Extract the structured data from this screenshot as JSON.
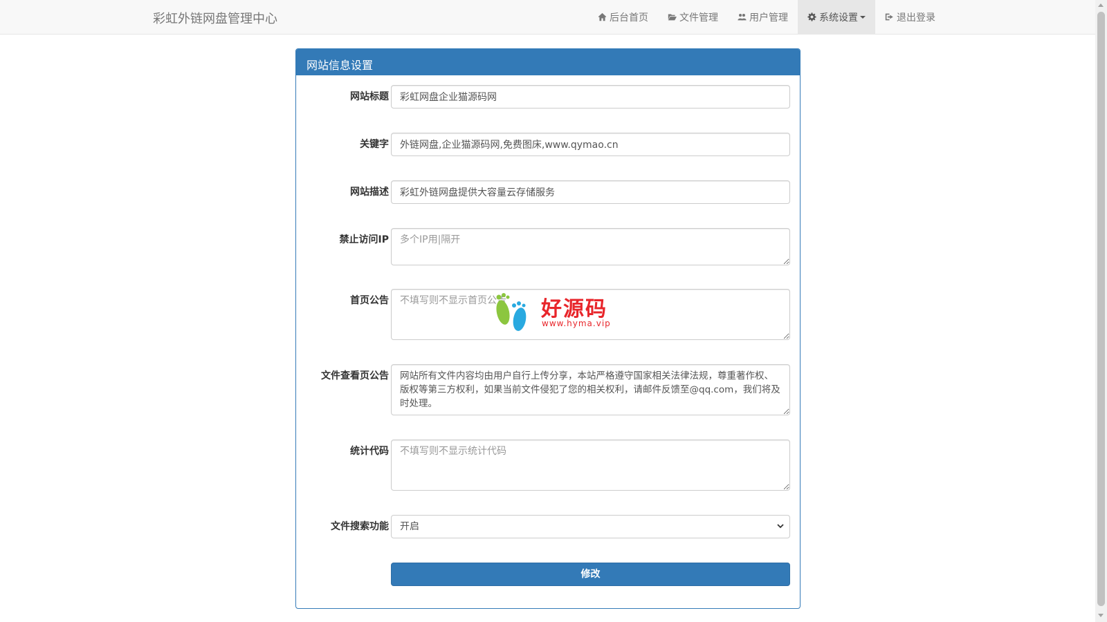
{
  "navbar": {
    "brand": "彩虹外链网盘管理中心",
    "items": [
      {
        "label": "后台首页",
        "icon": "home-icon"
      },
      {
        "label": "文件管理",
        "icon": "folder-open-icon"
      },
      {
        "label": "用户管理",
        "icon": "users-icon"
      },
      {
        "label": "系统设置",
        "icon": "gear-icon",
        "active": true
      },
      {
        "label": "退出登录",
        "icon": "sign-out-icon"
      }
    ]
  },
  "panel": {
    "title": "网站信息设置",
    "fields": {
      "site_title": {
        "label": "网站标题",
        "value": "彩虹网盘企业猫源码网"
      },
      "keywords": {
        "label": "关键字",
        "value": "外链网盘,企业猫源码网,免费图床,www.qymao.cn"
      },
      "description": {
        "label": "网站描述",
        "value": "彩虹外链网盘提供大容量云存储服务"
      },
      "banned_ip": {
        "label": "禁止访问IP",
        "placeholder": "多个IP用|隔开"
      },
      "home_notice": {
        "label": "首页公告",
        "placeholder": "不填写则不显示首页公告"
      },
      "file_notice": {
        "label": "文件查看页公告",
        "value": "网站所有文件内容均由用户自行上传分享，本站严格遵守国家相关法律法规，尊重著作权、版权等第三方权利，如果当前文件侵犯了您的相关权利，请邮件反馈至@qq.com，我们将及时处理。"
      },
      "stats_code": {
        "label": "统计代码",
        "placeholder": "不填写则不显示统计代码"
      },
      "file_search": {
        "label": "文件搜索功能",
        "value": "开启"
      }
    },
    "submit_label": "修改"
  },
  "watermark": {
    "text": "好源码",
    "url": "www.hyma.vip"
  },
  "colors": {
    "primary": "#337ab7",
    "navbar_bg": "#f8f8f8",
    "watermark_red": "#e8262b",
    "watermark_green": "#8cc63f",
    "watermark_blue": "#29a9e0"
  }
}
